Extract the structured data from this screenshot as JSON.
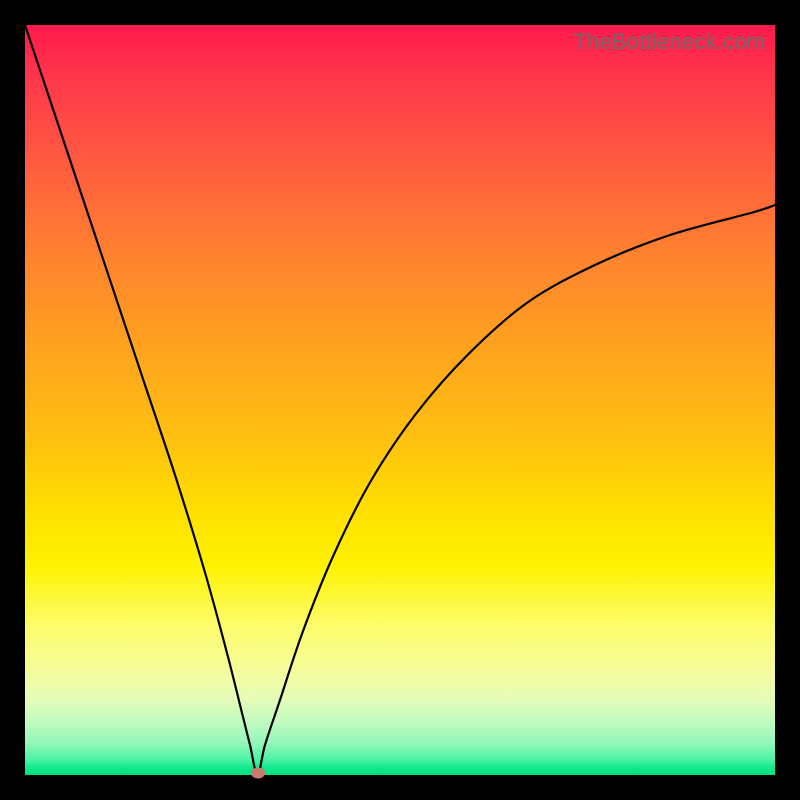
{
  "watermark": "TheBottleneck.com",
  "colors": {
    "marker": "#cc7a6e",
    "curve": "#000000"
  },
  "chart_data": {
    "type": "line",
    "title": "",
    "xlabel": "",
    "ylabel": "",
    "xlim": [
      0,
      100
    ],
    "ylim": [
      0,
      100
    ],
    "grid": false,
    "legend": false,
    "annotations": [
      "TheBottleneck.com"
    ],
    "marker": {
      "x": 31,
      "y": 0
    },
    "series": [
      {
        "name": "bottleneck-curve",
        "x": [
          0,
          4,
          8,
          12,
          16,
          20,
          24,
          27,
          29,
          30,
          31,
          32,
          34,
          37,
          41,
          46,
          52,
          59,
          67,
          76,
          86,
          97,
          100
        ],
        "y": [
          100,
          88,
          76,
          64,
          52,
          40,
          27,
          16,
          8,
          4,
          0,
          4,
          10,
          19,
          29,
          39,
          48,
          56,
          63,
          68,
          72,
          75,
          76
        ]
      }
    ]
  }
}
